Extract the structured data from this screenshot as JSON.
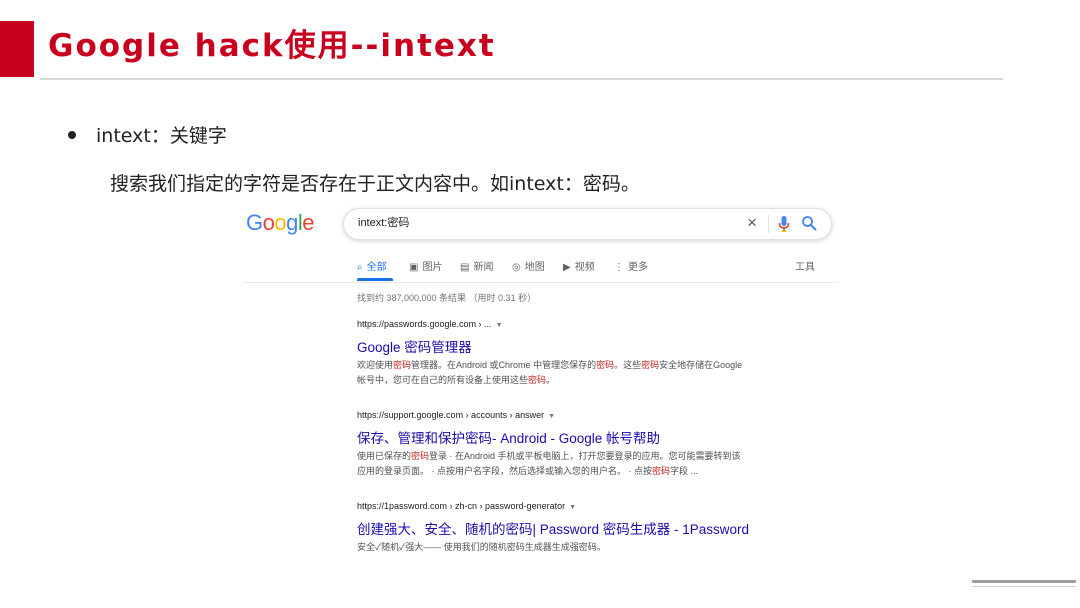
{
  "slide": {
    "title": "Google hack使用--intext",
    "bullet": "intext：关键字",
    "description": "搜索我们指定的字符是否存在于正文内容中。如intext：密码。"
  },
  "google": {
    "logo_letters": [
      "G",
      "o",
      "o",
      "g",
      "l",
      "e"
    ],
    "logo_colors": [
      "#4285F4",
      "#EA4335",
      "#FBBC05",
      "#4285F4",
      "#34A853",
      "#EA4335"
    ],
    "query": "intext:密码",
    "clear_glyph": "×",
    "tabs": [
      {
        "icon": "⌕",
        "label": "全部"
      },
      {
        "icon": "▣",
        "label": "图片"
      },
      {
        "icon": "▤",
        "label": "新闻"
      },
      {
        "icon": "◎",
        "label": "地图"
      },
      {
        "icon": "▶",
        "label": "视频"
      },
      {
        "icon": "⋮",
        "label": "更多"
      }
    ],
    "tools_label": "工具",
    "stats": "找到约 387,000,000 条结果 （用时 0.31 秒）",
    "results": [
      {
        "url": "https://passwords.google.com › ...",
        "title": "Google 密码管理器",
        "snippet_lines": [
          [
            "欢迎使用",
            "密码",
            "管理器。在Android 或Chrome 中管理您保存的",
            "密码",
            "。这些",
            "密码",
            "安全地存储在Google"
          ],
          [
            "帐号中，您可在自己的所有设备上使用这些",
            "密码",
            "。"
          ]
        ]
      },
      {
        "url": "https://support.google.com › accounts › answer",
        "title": "保存、管理和保护密码- Android - Google 帐号帮助",
        "snippet_lines": [
          [
            "使用已保存的",
            "密码",
            "登录 · 在Android 手机或平板电脑上，打开您要登录的应用。您可能需要转到该"
          ],
          [
            "应用的登录页面。 · 点按用户名字段，然后选择或输入您的用户名。 · 点按",
            "密码",
            "字段 ..."
          ]
        ]
      },
      {
        "url": "https://1password.com › zh-cn › password-generator",
        "title": "创建强大、安全、随机的密码| Password 密码生成器 - 1Password",
        "snippet_lines": [
          [
            "安全✓随机✓强大—— 使用我们的随机密码生成器生成强密码。"
          ]
        ]
      }
    ],
    "colors": {
      "title_red": "#c8001e",
      "link_blue": "#1a0dab",
      "active_tab_blue": "#1a73e8",
      "highlight_red": "#c5221f"
    }
  }
}
